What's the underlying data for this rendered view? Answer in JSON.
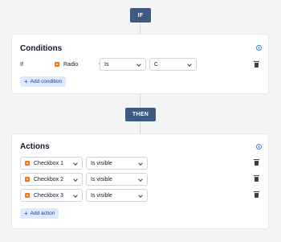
{
  "if_label": "IF",
  "then_label": "THEN",
  "conditions": {
    "title": "Conditions",
    "row": {
      "prefix": "If",
      "field": "Radio",
      "operator": "Is",
      "value": "C"
    },
    "add_label": "Add condition"
  },
  "actions": {
    "title": "Actions",
    "rows": [
      {
        "field": "Checkbox 1",
        "action": "Is visible"
      },
      {
        "field": "Checkbox 2",
        "action": "Is visible"
      },
      {
        "field": "Checkbox 3",
        "action": "Is visible"
      }
    ],
    "add_label": "Add action"
  },
  "colors": {
    "pill": "#3d5a80",
    "accent": "#3b82f6",
    "field_icon": "#f97316",
    "add_bg": "#dbeafe"
  },
  "icons": [
    "info-icon",
    "radio-field-icon",
    "checkbox-field-icon",
    "chevron-down-icon",
    "trash-icon",
    "plus-icon"
  ]
}
